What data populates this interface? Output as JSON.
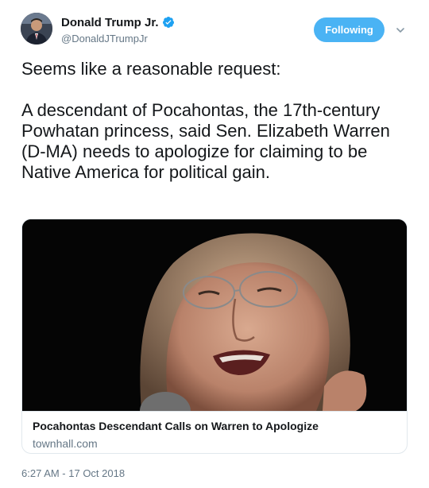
{
  "author": {
    "display_name": "Donald Trump Jr.",
    "handle": "@DonaldJTrumpJr",
    "verified": true,
    "avatar_icon": "profile-photo"
  },
  "actions": {
    "follow_label": "Following",
    "menu_icon": "chevron-down-icon"
  },
  "tweet": {
    "lines_1": "Seems like a reasonable request:",
    "lines_2": "A descendant of Pocahontas, the 17th-century Powhatan princess, said Sen. Elizabeth Warren (D-MA) needs to apologize for claiming to be Native America for political gain."
  },
  "card": {
    "image": "photo-of-woman-speaking-into-microphone",
    "title": "Pocahontas Descendant Calls on Warren to Apologize",
    "domain": "townhall.com"
  },
  "timestamp": "6:27 AM - 17 Oct 2018",
  "colors": {
    "accent": "#4ab3f4",
    "verified": "#1da1f2",
    "text": "#14171a",
    "muted": "#657786",
    "border": "#e1e8ed"
  }
}
